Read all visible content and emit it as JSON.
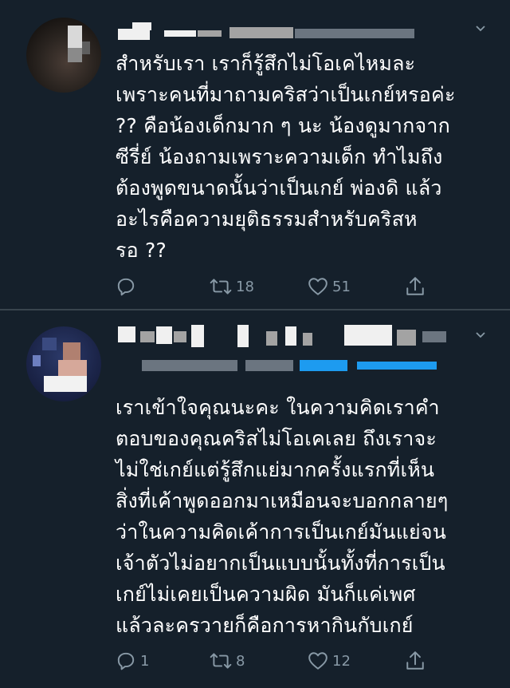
{
  "tweets": [
    {
      "body": "สำหรับเรา เราก็รู้สึกไม่โอเคไหมละ\nเพราะคนที่มาถามคริสว่าเป็นเกย์หรอค่ะ\n?? คือน้องเด็กมาก ๆ นะ น้องดูมากจาก\nซีรี่ย์ น้องถามเพราะความเด็ก ทำไมถึง\nต้องพูดขนาดนั้นว่าเป็นเกย์ พ่องดิ แล้ว\nอะไรคือความยุติธรรมสำหรับคริสห\nรอ ??",
      "reply_count": "",
      "retweet_count": "18",
      "like_count": "51"
    },
    {
      "body": "เราเข้าใจคุณนะคะ ในความคิดเราคำ\nตอบของคุณคริสไม่โอเคเลย ถึงเราจะ\nไม่ใช่เกย์แต่รู้สึกแย่มากครั้งแรกที่เห็น\nสิ่งที่เค้าพูดออกมาเหมือนจะบอกกลายๆ\nว่าในความคิดเค้าการเป็นเกย์มันแย่จน\nเจ้าตัวไม่อยากเป็นแบบนั้นทั้งที่การเป็น\nเกย์ไม่เคยเป็นความผิด มันก็แค่เพศ\nแล้วละครวายก็คือการหากินกับเกย์",
      "reply_count": "1",
      "retweet_count": "8",
      "like_count": "12"
    }
  ],
  "colors": {
    "background": "#15202b",
    "text": "#ffffff",
    "muted": "#8899a6",
    "divider": "#38444d"
  },
  "icons": [
    "reply-icon",
    "retweet-icon",
    "like-icon",
    "share-icon",
    "more-chevron-icon"
  ]
}
